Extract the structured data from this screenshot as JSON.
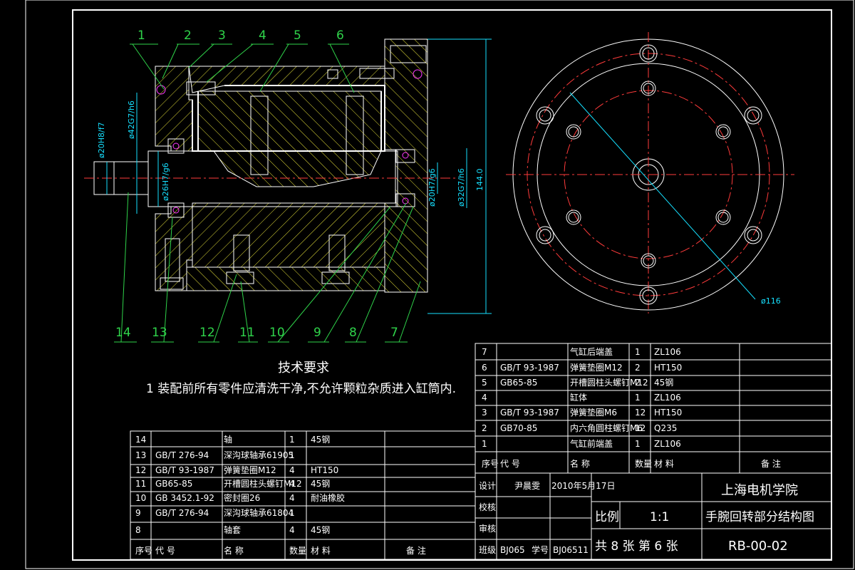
{
  "balloons": [
    "1",
    "2",
    "3",
    "4",
    "5",
    "6",
    "7",
    "8",
    "9",
    "10",
    "11",
    "12",
    "13",
    "14"
  ],
  "dims": {
    "d20h8": "ø20H8/f7",
    "d42g7": "ø42G7/h6",
    "d26h7": "ø26H7/g6",
    "d20h7": "ø20H7/g6",
    "d32g7": "ø32G7/h6",
    "len144": "144.0",
    "d116": "ø116"
  },
  "tech": {
    "title": "技术要求",
    "line1": "1 装配前所有零件应清洗干净,不允许颗粒杂质进入缸筒内."
  },
  "bom_left": {
    "rows": [
      [
        "14",
        "",
        "轴",
        "1",
        "45钢",
        ""
      ],
      [
        "13",
        "GB/T 276-94",
        "深沟球轴承61905",
        "1",
        "",
        ""
      ],
      [
        "12",
        "GB/T 93-1987",
        "弹簧垫圈M12",
        "4",
        "HT150",
        ""
      ],
      [
        "11",
        "GB65-85",
        "开槽圆柱头螺钉M12",
        "4",
        "45钢",
        ""
      ],
      [
        "10",
        "GB 3452.1-92",
        "密封圈26",
        "4",
        "耐油橡胶",
        ""
      ],
      [
        "9",
        "GB/T 276-94",
        "深沟球轴承61804",
        "1",
        "",
        ""
      ],
      [
        "8",
        "",
        "轴套",
        "4",
        "45钢",
        ""
      ]
    ],
    "header": [
      "序号",
      "代  号",
      "名  称",
      "数量",
      "材    料",
      "备   注"
    ]
  },
  "bom_right": {
    "rows": [
      [
        "7",
        "",
        "气缸后端盖",
        "1",
        "ZL106",
        ""
      ],
      [
        "6",
        "GB/T 93-1987",
        "弹簧垫圈M12",
        "2",
        "HT150",
        ""
      ],
      [
        "5",
        "GB65-85",
        "开槽圆柱头螺钉M12",
        "2",
        "45钢",
        ""
      ],
      [
        "4",
        "",
        "缸体",
        "1",
        "ZL106",
        ""
      ],
      [
        "3",
        "GB/T 93-1987",
        "弹簧垫圈M6",
        "12",
        "HT150",
        ""
      ],
      [
        "2",
        "GB70-85",
        "内六角圆柱螺钉M6",
        "12",
        "Q235",
        ""
      ],
      [
        "1",
        "",
        "气缸前端盖",
        "1",
        "ZL106",
        ""
      ]
    ],
    "header": [
      "序号",
      "代  号",
      "名  称",
      "数量",
      "材    料",
      "备   注"
    ]
  },
  "titleblock": {
    "design": "设计",
    "designer": "尹晨雯",
    "date": "2010年5月17日",
    "check": "校核",
    "review": "审核",
    "class_label": "班级",
    "class_value": "BJ065",
    "sid_label": "学号",
    "sid_value": "BJ06511",
    "school": "上海电机学院",
    "scale_label": "比例",
    "scale_value": "1:1",
    "drawing_name": "手腕回转部分结构图",
    "sheets": "共 8 张 第 6 张",
    "code": "RB-00-02"
  }
}
